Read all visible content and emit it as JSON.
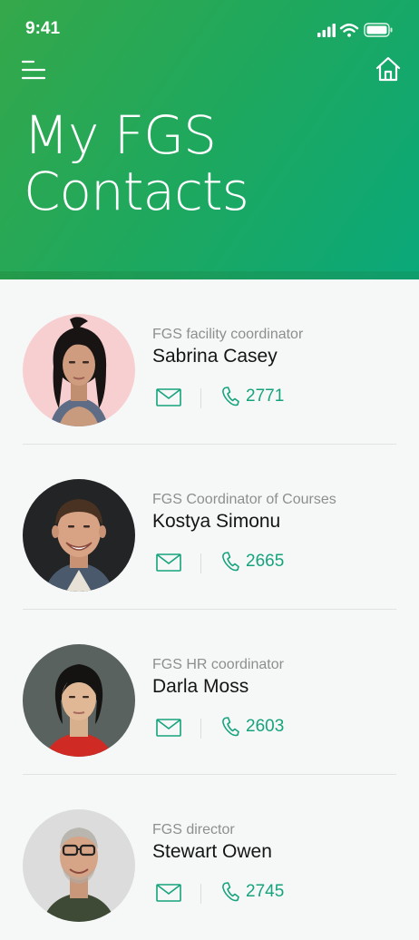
{
  "status_bar": {
    "time": "9:41"
  },
  "header": {
    "title_line1": "My FGS",
    "title_line2": "Contacts",
    "menu_icon": "hamburger-menu-icon",
    "home_icon": "home-icon"
  },
  "colors": {
    "accent": "#16a37c",
    "header_start": "#35a84a",
    "header_end": "#0aa87a"
  },
  "contacts": [
    {
      "role": "FGS facility coordinator",
      "name": "Sabrina Casey",
      "ext": "2771"
    },
    {
      "role": "FGS Coordinator of Courses",
      "name": "Kostya Simonu",
      "ext": "2665"
    },
    {
      "role": "FGS HR coordinator",
      "name": "Darla Moss",
      "ext": "2603"
    },
    {
      "role": "FGS director",
      "name": "Stewart Owen",
      "ext": "2745"
    }
  ]
}
